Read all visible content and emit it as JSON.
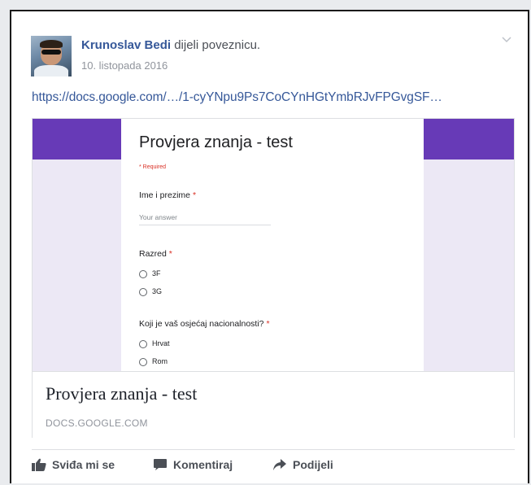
{
  "post": {
    "author_name": "Krunoslav Bedi",
    "action_text": "dijeli poveznicu.",
    "date": "10. listopada 2016",
    "link_url": "https://docs.google.com/…/1-cyYNpu9Ps7CoCYnHGtYmbRJvFPGvgSF…"
  },
  "preview": {
    "form_title": "Provjera znanja - test",
    "required_note": "* Required",
    "questions": [
      {
        "label": "Ime i prezime",
        "star": "*",
        "placeholder": "Your answer"
      },
      {
        "label": "Razred",
        "star": "*",
        "options": [
          "3F",
          "3G"
        ]
      },
      {
        "label": "Koji je vaš osjećaj nacionalnosti?",
        "star": "*",
        "options": [
          "Hrvat",
          "Rom"
        ]
      }
    ],
    "colors": {
      "header": "#673ab7",
      "background": "#ece8f5"
    }
  },
  "card": {
    "title": "Provjera znanja - test",
    "domain": "DOCS.GOOGLE.COM"
  },
  "actions": {
    "like": "Sviđa mi se",
    "comment": "Komentiraj",
    "share": "Podijeli"
  },
  "icons": [
    "chevron-down-icon",
    "thumbs-up-icon",
    "comment-icon",
    "share-arrow-icon"
  ],
  "colors": {
    "link": "#365899",
    "muted": "#90949c",
    "text": "#4b4f56"
  }
}
